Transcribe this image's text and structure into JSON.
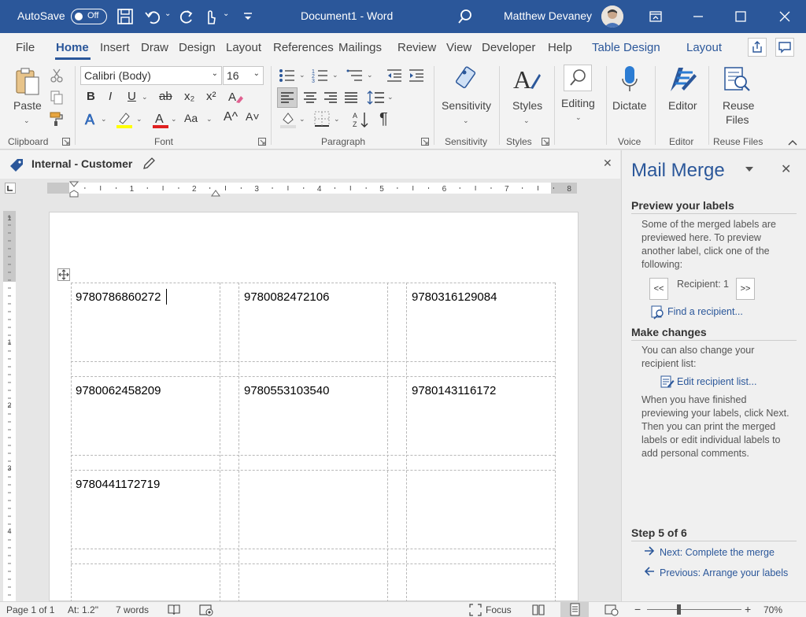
{
  "titlebar": {
    "autosave_label": "AutoSave",
    "autosave_state": "Off",
    "doc_title": "Document1  -  Word",
    "user_name": "Matthew Devaney"
  },
  "tabs": [
    {
      "label": "File"
    },
    {
      "label": "Home"
    },
    {
      "label": "Insert"
    },
    {
      "label": "Draw"
    },
    {
      "label": "Design"
    },
    {
      "label": "Layout"
    },
    {
      "label": "References"
    },
    {
      "label": "Mailings"
    },
    {
      "label": "Review"
    },
    {
      "label": "View"
    },
    {
      "label": "Developer"
    },
    {
      "label": "Help"
    },
    {
      "label": "Table Design"
    },
    {
      "label": "Layout"
    }
  ],
  "ribbon": {
    "clipboard": {
      "paste": "Paste",
      "group": "Clipboard"
    },
    "font": {
      "name": "Calibri (Body)",
      "size": "16",
      "group": "Font",
      "bold": "B",
      "italic": "I",
      "underline": "U",
      "strike": "ab",
      "sub": "x₂",
      "sup": "x²",
      "grow": "A^",
      "shrink": "A˅",
      "case": "Aa"
    },
    "paragraph": {
      "group": "Paragraph"
    },
    "sensitivity": {
      "label": "Sensitivity",
      "group": "Sensitivity"
    },
    "styles": {
      "label": "Styles",
      "group": "Styles"
    },
    "editing": {
      "label": "Editing"
    },
    "voice": {
      "label": "Dictate",
      "group": "Voice"
    },
    "editor": {
      "label": "Editor",
      "group": "Editor"
    },
    "reuse": {
      "label1": "Reuse",
      "label2": "Files",
      "group": "Reuse Files"
    }
  },
  "document": {
    "sensitivity_label": "Internal - Customer",
    "ruler_numbers": [
      "1",
      "2",
      "3",
      "4",
      "5",
      "6",
      "7",
      "8"
    ],
    "vruler_numbers": [
      "1",
      "1",
      "2",
      "3",
      "4"
    ],
    "labels": [
      [
        "9780786860272",
        "9780082472106",
        "9780316129084"
      ],
      [
        "9780062458209",
        "9780553103540",
        "9780143116172"
      ],
      [
        "9780441172719",
        "",
        ""
      ]
    ]
  },
  "panel": {
    "title": "Mail Merge",
    "preview_heading": "Preview your labels",
    "preview_text": "Some of the merged labels are previewed here. To preview another label, click one of the following:",
    "prev_btn": "<<",
    "recipient": "Recipient: 1",
    "next_btn": ">>",
    "find_link": "Find a recipient...",
    "changes_heading": "Make changes",
    "changes_text": "You can also change your recipient list:",
    "edit_link": "Edit recipient list...",
    "finish_text": "When you have finished previewing your labels, click Next. Then you can print the merged labels or edit individual labels to add personal comments.",
    "step": "Step 5 of 6",
    "next_link": "Next: Complete the merge",
    "prev_link": "Previous: Arrange your labels"
  },
  "status": {
    "page": "Page 1 of 1",
    "at": "At: 1.2\"",
    "words": "7 words",
    "focus": "Focus",
    "zoom": "70%",
    "minus": "−",
    "plus": "+"
  }
}
